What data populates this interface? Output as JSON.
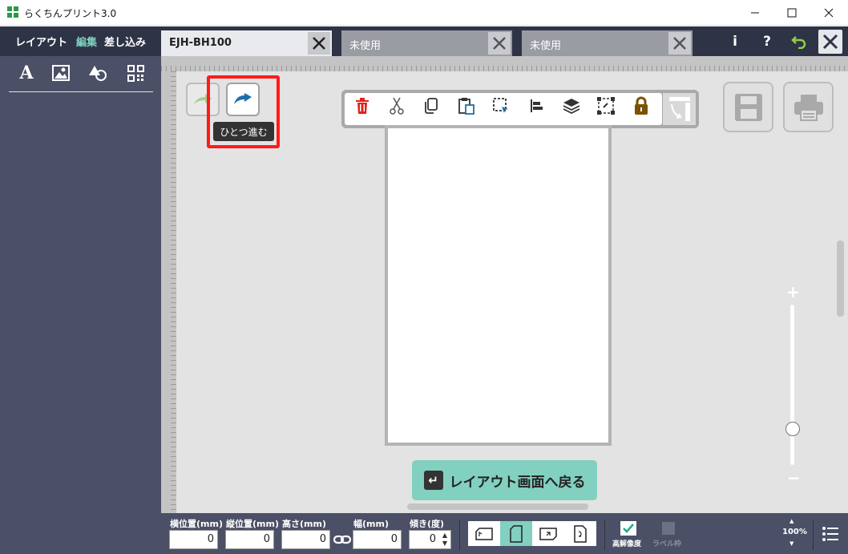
{
  "window": {
    "title": "らくちんプリント3.0",
    "minimize_icon": "minimize-icon",
    "maximize_icon": "maximize-icon",
    "close_icon": "close-icon"
  },
  "sidebar": {
    "tabs": [
      {
        "label": "レイアウト",
        "active": false
      },
      {
        "label": "編集",
        "active": true
      },
      {
        "label": "差し込み",
        "active": false
      }
    ],
    "tools": [
      {
        "icon": "text-icon",
        "glyph": "A"
      },
      {
        "icon": "image-icon"
      },
      {
        "icon": "shape-icon"
      },
      {
        "icon": "qrcode-icon"
      }
    ]
  },
  "tabs": [
    {
      "label": "EJH-BH100",
      "active": true
    },
    {
      "label": "未使用",
      "active": false
    },
    {
      "label": "未使用",
      "active": false
    }
  ],
  "header_buttons": {
    "info_label": "i",
    "help_label": "?",
    "undo_icon": "return-icon",
    "close_icon": "close-icon"
  },
  "canvas": {
    "undo_icon": "undo-icon",
    "redo_icon": "redo-icon",
    "redo_tooltip": "ひとつ進む",
    "toolbar": [
      "trash-icon",
      "cut-icon",
      "copy-icon",
      "paste-icon",
      "select-icon",
      "align-icon",
      "layers-icon",
      "group-icon",
      "lock-icon"
    ],
    "rotate_icon": "rotate-icon",
    "save_icon": "save-icon",
    "print_icon": "print-icon",
    "zoom_plus": "+",
    "zoom_minus": "−",
    "zoom_slider_level": 0.25,
    "back_button_label": "レイアウト画面へ戻る",
    "back_icon_glyph": "↵"
  },
  "bottom": {
    "x_label": "横位置(mm)",
    "x_value": "0",
    "y_label": "縦位置(mm)",
    "y_value": "0",
    "height_label": "高さ(mm)",
    "height_value": "0",
    "width_label": "幅(mm)",
    "width_value": "0",
    "angle_label": "傾き(度)",
    "angle_value": "0",
    "orientations": [
      "orientation-1-icon",
      "orientation-2-icon",
      "orientation-3-icon",
      "orientation-4-icon"
    ],
    "selected_orientation": 1,
    "hires_label": "高解像度",
    "hires_checked": true,
    "labelframe_label": "ラベル枠",
    "labelframe_checked": false,
    "zoom_level": "100%"
  },
  "colors": {
    "sidebar_bg": "#4b5066",
    "header_bg": "#2f3346",
    "accent": "#82d0c0",
    "highlight": "#ff1a1a",
    "trash": "#e2231a",
    "lock": "#7a5200",
    "redo": "#1f6fa8"
  }
}
